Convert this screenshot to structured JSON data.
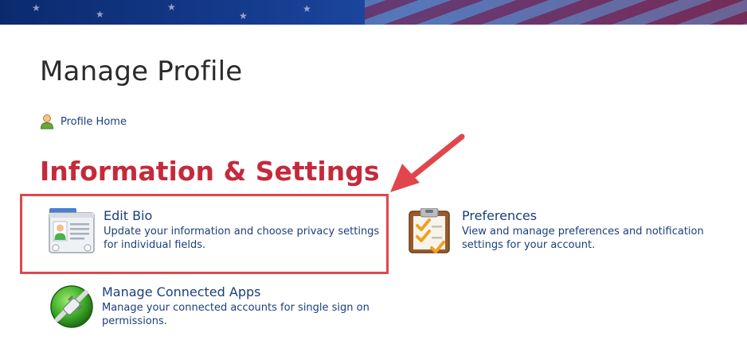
{
  "header": {
    "page_title": "Manage Profile",
    "profile_home_label": "Profile Home"
  },
  "section": {
    "heading": "Information & Settings"
  },
  "items": [
    {
      "title": "Edit Bio",
      "description": "Update your information and choose privacy settings for individual fields."
    },
    {
      "title": "Preferences",
      "description": "View and manage preferences and notification settings for your account."
    },
    {
      "title": "Manage Connected Apps",
      "description": "Manage your connected accounts for single sign on permissions."
    }
  ],
  "colors": {
    "heading_red": "#c52a3b",
    "link_blue": "#1a3f7a",
    "annotation_red": "#e0474c"
  },
  "icons": {
    "profile_home": "person-icon",
    "edit_bio": "id-card-icon",
    "preferences": "clipboard-checklist-icon",
    "connected_apps": "plug-connection-icon",
    "annotation": "red-arrow-annotation"
  }
}
